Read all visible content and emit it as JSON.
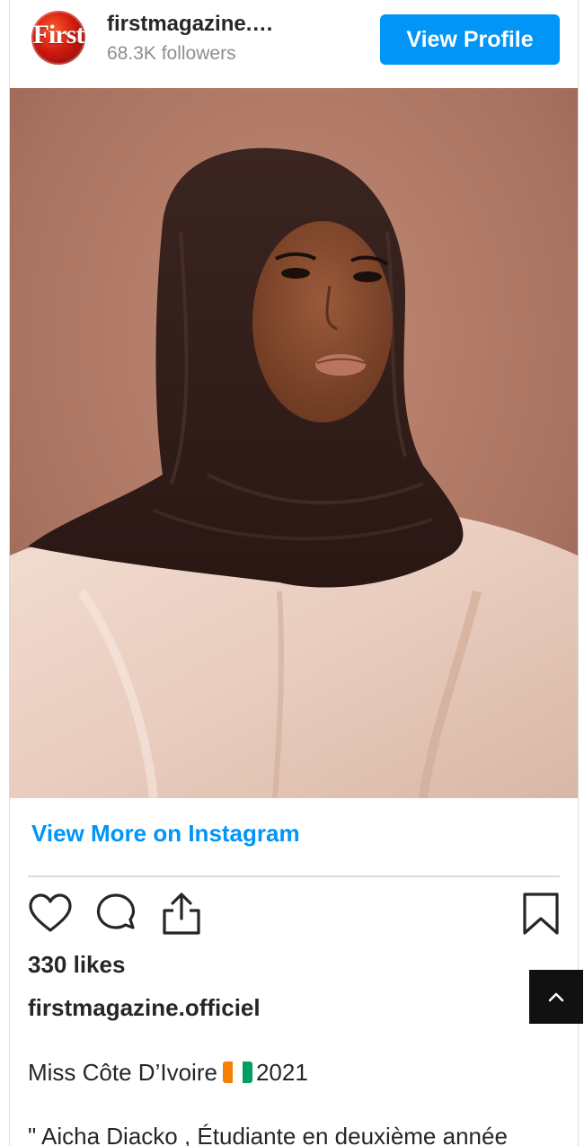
{
  "profile": {
    "name": "firstmagazine.officiel",
    "name_display": "firstmagazine.…",
    "followers": "68.3K followers",
    "avatar_text": "First",
    "view_profile_label": "View Profile"
  },
  "post": {
    "view_more_label": "View More on Instagram",
    "likes": "330 likes",
    "username": "firstmagazine.officiel",
    "caption_title_before_flag": "Miss Côte D’Ivoire",
    "caption_title_after_flag": "2021",
    "caption_line2": "\" Aicha Diacko , Étudiante en deuxième année"
  },
  "actions": {
    "like_icon": "heart-icon",
    "comment_icon": "comment-icon",
    "share_icon": "share-icon",
    "save_icon": "bookmark-icon"
  },
  "colors": {
    "accent": "#0095f6",
    "text": "#262626",
    "muted": "#8e8e8e",
    "divider": "#dbdbdb",
    "scroll_button": "#111111"
  },
  "scroll_top_icon": "chevron-up-icon"
}
